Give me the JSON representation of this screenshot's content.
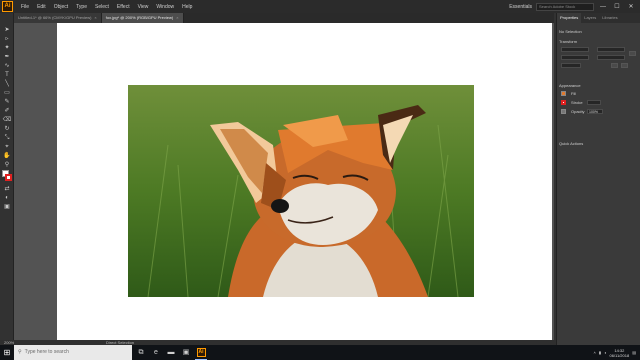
{
  "app": {
    "logo": "Ai"
  },
  "menu": [
    "File",
    "Edit",
    "Object",
    "Type",
    "Select",
    "Effect",
    "View",
    "Window",
    "Help"
  ],
  "workspace": {
    "label": "Essentials",
    "search_placeholder": "Search Adobe Stock"
  },
  "window_controls": {
    "minimize": "—",
    "maximize": "☐",
    "close": "✕"
  },
  "tabs": [
    {
      "label": "Untitled-1* @ 66% (CMYK/GPU Preview)",
      "close": "×"
    },
    {
      "label": "fox.jpg* @ 200% (RGB/GPU Preview)",
      "close": "×"
    }
  ],
  "panel": {
    "tabs": [
      "Properties",
      "Layers",
      "Libraries"
    ],
    "selection": "No Selection",
    "transform_header": "Transform",
    "appearance_header": "Appearance",
    "fill_label": "Fill",
    "stroke_label": "Stroke",
    "opacity_label": "Opacity",
    "opacity_value": "100%",
    "quick_actions_header": "Quick Actions"
  },
  "status": {
    "zoom": "200%",
    "tool": "Direct Selection"
  },
  "taskbar": {
    "search_placeholder": "Type here to search",
    "time": "14:32",
    "date": "06/11/2018"
  },
  "icons": {
    "start": "windows-icon",
    "search": "search-icon",
    "task_view": "task-view-icon",
    "edge": "edge-icon",
    "explorer": "folder-icon",
    "store": "store-icon",
    "illustrator": "illustrator-icon"
  },
  "colors": {
    "accent": "#ff9a00",
    "stroke_swatch": "#e02020",
    "fox_orange": "#e07a2e"
  }
}
